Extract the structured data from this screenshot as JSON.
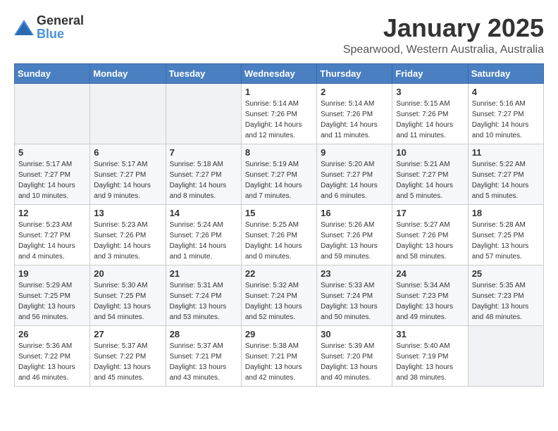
{
  "header": {
    "logo_general": "General",
    "logo_blue": "Blue",
    "title": "January 2025",
    "subtitle": "Spearwood, Western Australia, Australia"
  },
  "weekdays": [
    "Sunday",
    "Monday",
    "Tuesday",
    "Wednesday",
    "Thursday",
    "Friday",
    "Saturday"
  ],
  "weeks": [
    [
      {
        "day": "",
        "info": ""
      },
      {
        "day": "",
        "info": ""
      },
      {
        "day": "",
        "info": ""
      },
      {
        "day": "1",
        "info": "Sunrise: 5:14 AM\nSunset: 7:26 PM\nDaylight: 14 hours\nand 12 minutes."
      },
      {
        "day": "2",
        "info": "Sunrise: 5:14 AM\nSunset: 7:26 PM\nDaylight: 14 hours\nand 11 minutes."
      },
      {
        "day": "3",
        "info": "Sunrise: 5:15 AM\nSunset: 7:26 PM\nDaylight: 14 hours\nand 11 minutes."
      },
      {
        "day": "4",
        "info": "Sunrise: 5:16 AM\nSunset: 7:27 PM\nDaylight: 14 hours\nand 10 minutes."
      }
    ],
    [
      {
        "day": "5",
        "info": "Sunrise: 5:17 AM\nSunset: 7:27 PM\nDaylight: 14 hours\nand 10 minutes."
      },
      {
        "day": "6",
        "info": "Sunrise: 5:17 AM\nSunset: 7:27 PM\nDaylight: 14 hours\nand 9 minutes."
      },
      {
        "day": "7",
        "info": "Sunrise: 5:18 AM\nSunset: 7:27 PM\nDaylight: 14 hours\nand 8 minutes."
      },
      {
        "day": "8",
        "info": "Sunrise: 5:19 AM\nSunset: 7:27 PM\nDaylight: 14 hours\nand 7 minutes."
      },
      {
        "day": "9",
        "info": "Sunrise: 5:20 AM\nSunset: 7:27 PM\nDaylight: 14 hours\nand 6 minutes."
      },
      {
        "day": "10",
        "info": "Sunrise: 5:21 AM\nSunset: 7:27 PM\nDaylight: 14 hours\nand 5 minutes."
      },
      {
        "day": "11",
        "info": "Sunrise: 5:22 AM\nSunset: 7:27 PM\nDaylight: 14 hours\nand 5 minutes."
      }
    ],
    [
      {
        "day": "12",
        "info": "Sunrise: 5:23 AM\nSunset: 7:27 PM\nDaylight: 14 hours\nand 4 minutes."
      },
      {
        "day": "13",
        "info": "Sunrise: 5:23 AM\nSunset: 7:26 PM\nDaylight: 14 hours\nand 3 minutes."
      },
      {
        "day": "14",
        "info": "Sunrise: 5:24 AM\nSunset: 7:26 PM\nDaylight: 14 hours\nand 1 minute."
      },
      {
        "day": "15",
        "info": "Sunrise: 5:25 AM\nSunset: 7:26 PM\nDaylight: 14 hours\nand 0 minutes."
      },
      {
        "day": "16",
        "info": "Sunrise: 5:26 AM\nSunset: 7:26 PM\nDaylight: 13 hours\nand 59 minutes."
      },
      {
        "day": "17",
        "info": "Sunrise: 5:27 AM\nSunset: 7:26 PM\nDaylight: 13 hours\nand 58 minutes."
      },
      {
        "day": "18",
        "info": "Sunrise: 5:28 AM\nSunset: 7:25 PM\nDaylight: 13 hours\nand 57 minutes."
      }
    ],
    [
      {
        "day": "19",
        "info": "Sunrise: 5:29 AM\nSunset: 7:25 PM\nDaylight: 13 hours\nand 56 minutes."
      },
      {
        "day": "20",
        "info": "Sunrise: 5:30 AM\nSunset: 7:25 PM\nDaylight: 13 hours\nand 54 minutes."
      },
      {
        "day": "21",
        "info": "Sunrise: 5:31 AM\nSunset: 7:24 PM\nDaylight: 13 hours\nand 53 minutes."
      },
      {
        "day": "22",
        "info": "Sunrise: 5:32 AM\nSunset: 7:24 PM\nDaylight: 13 hours\nand 52 minutes."
      },
      {
        "day": "23",
        "info": "Sunrise: 5:33 AM\nSunset: 7:24 PM\nDaylight: 13 hours\nand 50 minutes."
      },
      {
        "day": "24",
        "info": "Sunrise: 5:34 AM\nSunset: 7:23 PM\nDaylight: 13 hours\nand 49 minutes."
      },
      {
        "day": "25",
        "info": "Sunrise: 5:35 AM\nSunset: 7:23 PM\nDaylight: 13 hours\nand 48 minutes."
      }
    ],
    [
      {
        "day": "26",
        "info": "Sunrise: 5:36 AM\nSunset: 7:22 PM\nDaylight: 13 hours\nand 46 minutes."
      },
      {
        "day": "27",
        "info": "Sunrise: 5:37 AM\nSunset: 7:22 PM\nDaylight: 13 hours\nand 45 minutes."
      },
      {
        "day": "28",
        "info": "Sunrise: 5:37 AM\nSunset: 7:21 PM\nDaylight: 13 hours\nand 43 minutes."
      },
      {
        "day": "29",
        "info": "Sunrise: 5:38 AM\nSunset: 7:21 PM\nDaylight: 13 hours\nand 42 minutes."
      },
      {
        "day": "30",
        "info": "Sunrise: 5:39 AM\nSunset: 7:20 PM\nDaylight: 13 hours\nand 40 minutes."
      },
      {
        "day": "31",
        "info": "Sunrise: 5:40 AM\nSunset: 7:19 PM\nDaylight: 13 hours\nand 38 minutes."
      },
      {
        "day": "",
        "info": ""
      }
    ]
  ]
}
